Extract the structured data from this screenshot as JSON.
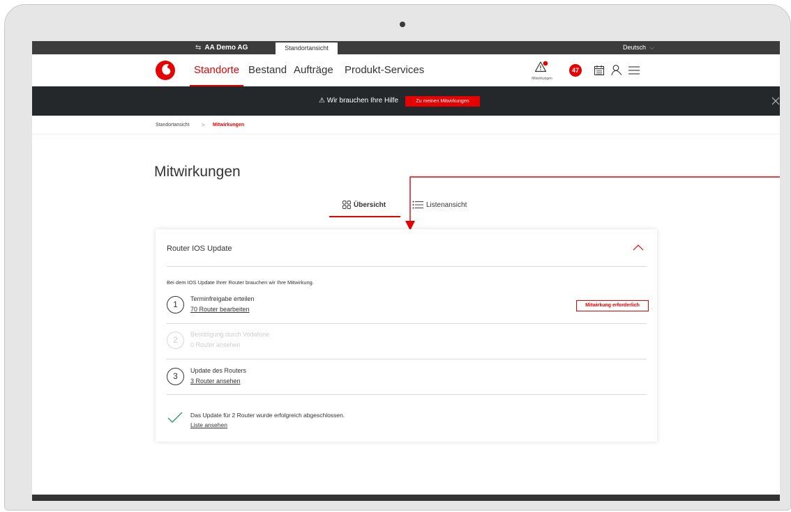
{
  "topbar": {
    "company": "AA Demo AG",
    "location_tab": "Standortansicht",
    "language": "Deutsch"
  },
  "nav": {
    "items": [
      "Standorte",
      "Bestand",
      "Aufträge",
      "Produkt-Services"
    ],
    "active": "Standorte",
    "alert_caption": "Mitwirkungen",
    "count": "47"
  },
  "banner": {
    "text": "Wir brauchen Ihre Hilfe",
    "button": "Zu meinen Mitwirkungen"
  },
  "breadcrumb": {
    "items": [
      "Standortansicht",
      "Mitwirkungen"
    ]
  },
  "page": {
    "title": "Mitwirkungen"
  },
  "tabs": {
    "overview": "Übersicht",
    "list": "Listenansicht"
  },
  "card": {
    "title": "Router IOS Update",
    "intro": "Bei dem IOS Update Ihrer Router brauchen wir Ihre Mitwirkung.",
    "steps": [
      {
        "number": "1",
        "title": "Terminfreigabe erteilen",
        "link": "70 Router bearbeiten",
        "badge": "Mitwirkung erforderlich"
      },
      {
        "number": "2",
        "title": "Bestätigung durch Vodafone",
        "link": "0 Router ansehen"
      },
      {
        "number": "3",
        "title": "Update des Routers",
        "link": "3 Router ansehen"
      }
    ],
    "done_text": "Das Update für 2 Router wurde erfolgreich abgeschlossen.",
    "done_link": "Liste ansehen"
  },
  "colors": {
    "brand": "#e60000",
    "banner_bg": "#25282b",
    "topbar_bg": "#3c3c3c",
    "success": "#2e9e6a"
  }
}
